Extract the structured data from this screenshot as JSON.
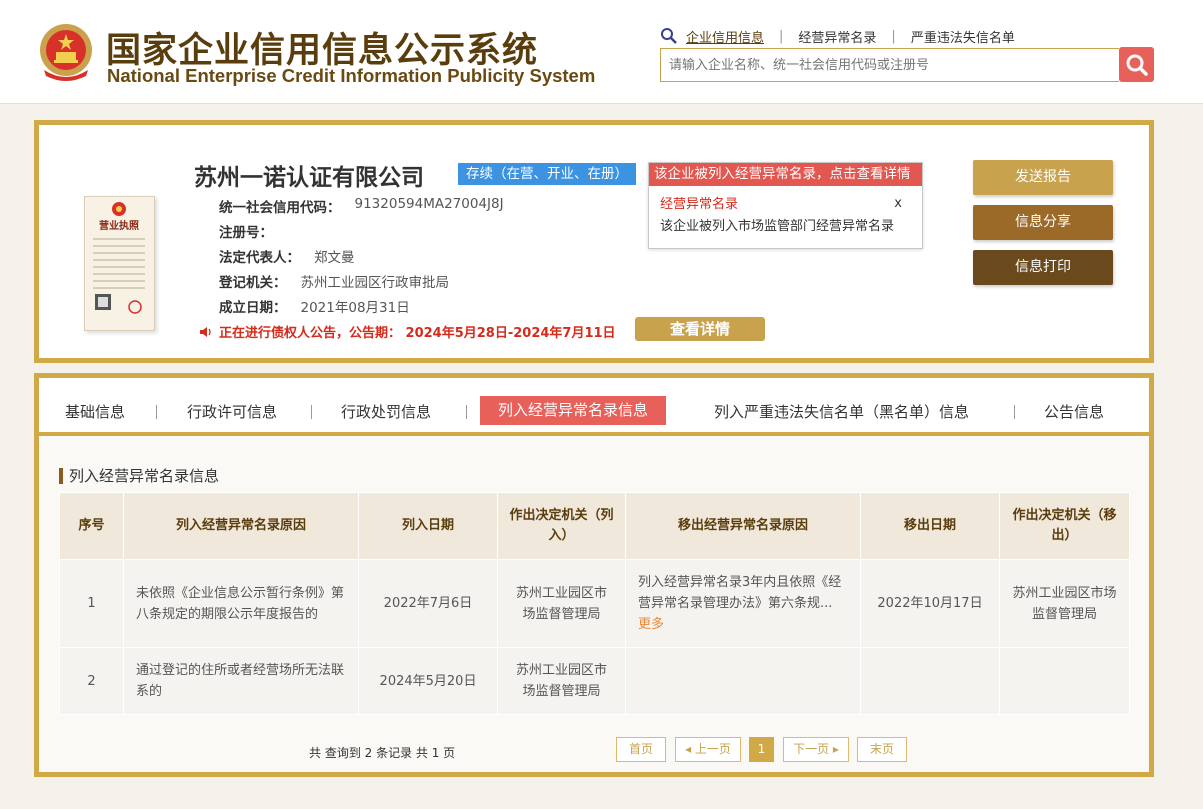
{
  "header": {
    "title_cn": "国家企业信用信息公示系统",
    "title_en": "National Enterprise Credit Information Publicity System",
    "nav": [
      {
        "label": "企业信用信息",
        "active": true
      },
      {
        "label": "经营异常名录",
        "active": false
      },
      {
        "label": "严重违法失信名单",
        "active": false
      }
    ],
    "search_placeholder": "请输入企业名称、统一社会信用代码或注册号"
  },
  "company": {
    "name": "苏州一诺认证有限公司",
    "status": "存续（在营、开业、在册）",
    "license_image_text": "营业执照",
    "fields": [
      {
        "label": "统一社会信用代码：",
        "value": "91320594MA27004J8J"
      },
      {
        "label": "注册号：",
        "value": ""
      },
      {
        "label": "法定代表人：",
        "value": "郑文曼"
      },
      {
        "label": "登记机关：",
        "value": "苏州工业园区行政审批局"
      },
      {
        "label": "成立日期：",
        "value": "2021年08月31日"
      }
    ],
    "notice": "正在进行债权人公告，公告期： 2024年5月28日-2024年7月11日",
    "detail_button": "查看详情",
    "abnormal_popup": {
      "header": "该企业被列入经营异常名录，点击查看详情",
      "title": "经营异常名录",
      "close": "x",
      "desc": "该企业被列入市场监管部门经营异常名录"
    },
    "actions": [
      {
        "label": "发送报告",
        "color": "#c9a24d"
      },
      {
        "label": "信息分享",
        "color": "#9c6a28"
      },
      {
        "label": "信息打印",
        "color": "#6a4a1c"
      }
    ]
  },
  "tabs": [
    {
      "label": "基础信息",
      "active": false
    },
    {
      "label": "行政许可信息",
      "active": false
    },
    {
      "label": "行政处罚信息",
      "active": false
    },
    {
      "label": "列入经营异常名录信息",
      "active": true
    },
    {
      "label": "列入严重违法失信名单（黑名单）信息",
      "active": false
    },
    {
      "label": "公告信息",
      "active": false
    }
  ],
  "section": {
    "title": "列入经营异常名录信息",
    "columns": [
      "序号",
      "列入经营异常名录原因",
      "列入日期",
      "作出决定机关（列入）",
      "移出经营异常名录原因",
      "移出日期",
      "作出决定机关（移出）"
    ],
    "rows": [
      {
        "no": "1",
        "reason": "未依照《企业信息公示暂行条例》第八条规定的期限公示年度报告的",
        "date": "2022年7月6日",
        "authority": "苏州工业园区市场监督管理局",
        "remove_reason": "列入经营异常名录3年内且依照《经营异常名录管理办法》第六条规...",
        "more": "更多",
        "remove_date": "2022年10月17日",
        "remove_authority": "苏州工业园区市场监督管理局"
      },
      {
        "no": "2",
        "reason": "通过登记的住所或者经营场所无法联系的",
        "date": "2024年5月20日",
        "authority": "苏州工业园区市场监督管理局",
        "remove_reason": "",
        "more": "",
        "remove_date": "",
        "remove_authority": ""
      }
    ]
  },
  "pager": {
    "summary": "共 查询到 2 条记录 共 1 页",
    "first": "首页",
    "prev": "上一页",
    "current": "1",
    "next": "下一页",
    "last": "末页"
  },
  "colors": {
    "gold": "#d1a947",
    "accent_red": "#e8605a",
    "status_blue": "#3c93e1",
    "brand_brown": "#5a3d0c"
  }
}
